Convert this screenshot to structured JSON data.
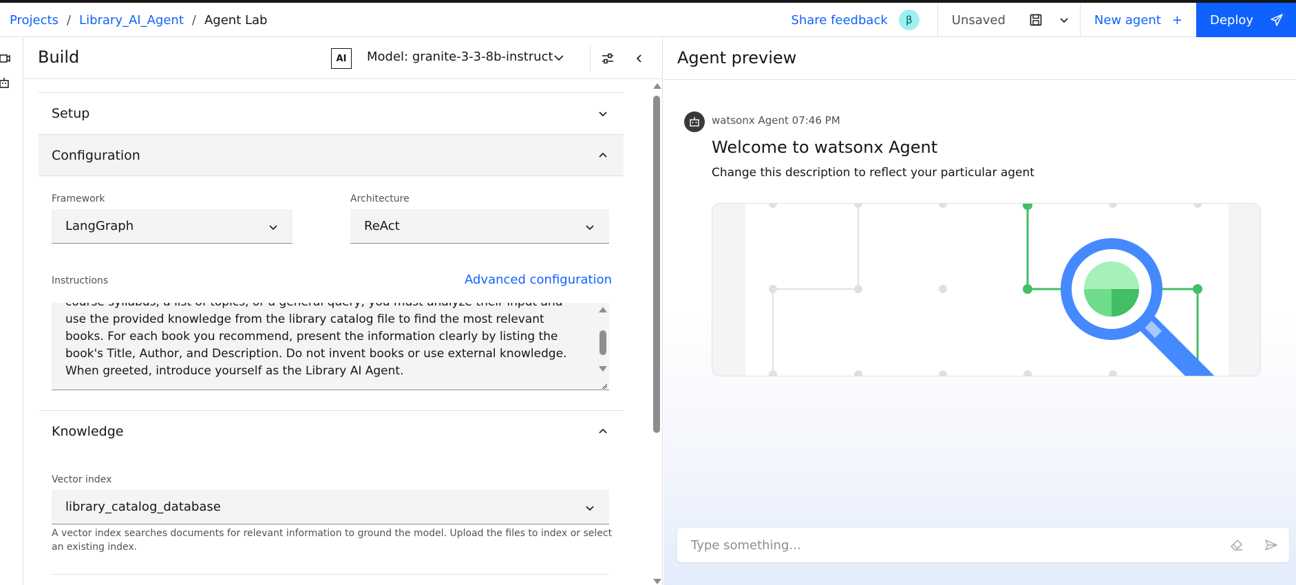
{
  "header": {
    "breadcrumbs": [
      "Projects",
      "Library_AI_Agent",
      "Agent Lab"
    ],
    "share_feedback": "Share feedback",
    "beta_badge": "β",
    "unsaved": "Unsaved",
    "new_agent": "New agent",
    "new_agent_plus": "+",
    "deploy": "Deploy"
  },
  "build": {
    "title": "Build",
    "ai_badge": "AI",
    "model_label": "Model: granite-3-3-8b-instruct",
    "sections": {
      "setup": "Setup",
      "configuration": "Configuration",
      "knowledge": "Knowledge"
    },
    "framework": {
      "label": "Framework",
      "value": "LangGraph"
    },
    "architecture": {
      "label": "Architecture",
      "value": "ReAct"
    },
    "instructions": {
      "label": "Instructions",
      "advanced": "Advanced configuration",
      "text": "course syllabus, a list of topics, or a general query, you must analyze their input and use the provided knowledge from the library catalog file to find the most relevant books. For each book you recommend, present the information clearly by listing the book's Title, Author, and Description. Do not invent books or use external knowledge. When greeted, introduce yourself as the Library AI Agent."
    },
    "vector_index": {
      "label": "Vector index",
      "value": "library_catalog_database",
      "helper": "A vector index searches documents for relevant information to ground the model. Upload the files to index or select an existing index."
    }
  },
  "preview": {
    "title": "Agent preview",
    "sender": "watsonx Agent 07:46 PM",
    "welcome": "Welcome to watsonx Agent",
    "description": "Change this description to reflect your particular agent",
    "input_placeholder": "Type something..."
  },
  "colors": {
    "accent": "#0f62fe",
    "green": "#42be65",
    "search_blue": "#4589ff"
  },
  "icons": [
    "save-icon",
    "chevron-down-icon",
    "plus-icon",
    "send-plane-icon",
    "tune-icon",
    "chevron-left-icon",
    "robot-icon",
    "eraser-icon",
    "send-icon",
    "video-icon"
  ]
}
